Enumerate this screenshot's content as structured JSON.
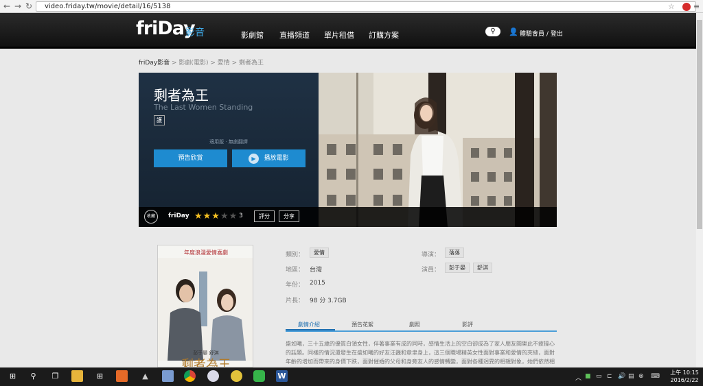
{
  "browser": {
    "url": "video.friday.tw/movie/detail/16/5138"
  },
  "header": {
    "logo_text": "friDay",
    "logo_sub": "影音",
    "nav": [
      "影劇館",
      "直播頻道",
      "單片租借",
      "訂購方案"
    ],
    "user_label": "體驗會員",
    "sep": "/",
    "logout": "登出"
  },
  "breadcrumb": [
    "friDay影音",
    "> 影劇(電影)",
    "> 愛情",
    "> 剩者為王"
  ],
  "movie": {
    "title": "剩者為王",
    "title_en": "The Last Women Standing",
    "rating_badge": "護",
    "subtitle_note": "適用版 · 無劇翻譯",
    "trailer_label": "預告欣賞",
    "play_label": "播放電影",
    "fav_label": "收藏",
    "brand": "friDay",
    "stars_on": "★★★",
    "stars_off": "★★",
    "score": "3",
    "rate_label": "評分",
    "share_label": "分享"
  },
  "poster": {
    "tagline": "年度浪漫愛情喜劇",
    "title": "剩者為王",
    "actors": "彭于晏 舒淇"
  },
  "info": {
    "genre_label": "類別：",
    "genre": "愛情",
    "region_label": "地區：",
    "region": "台灣",
    "year_label": "年份：",
    "year": "2015",
    "length_label": "片長：",
    "length": "98 分 3.7GB",
    "director_label": "導演：",
    "director": "落落",
    "cast_label": "演員：",
    "cast": [
      "彭于晏",
      "舒淇"
    ]
  },
  "tabs": [
    "劇情介紹",
    "預告花絮",
    "劇照",
    "影評"
  ],
  "description": "盛如曦，三十五歲的優質白領女性，伴著事業有成的同時，感情生活上的空白卻成為了家人朋友間樂此不疲操心的話題。同樣的情況還發生在盛如曦的好友汪巍和章聿身上，這三個職場精英女性面對事業和愛情的夾縫，面對年齡的增加而帶來的身價下跌，面對催婚的父母和身旁友人的感情轉變，面對各種迥異的相親對象，她們依然相信愛情……",
  "taskbar": {
    "time": "上午 10:15",
    "date": "2016/2/22"
  }
}
